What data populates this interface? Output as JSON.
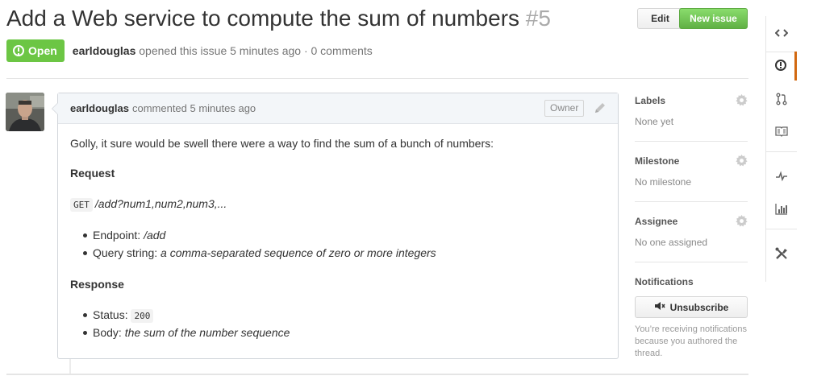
{
  "issue": {
    "title": "Add a Web service to compute the sum of numbers",
    "number": "#5",
    "state": "Open",
    "author": "earldouglas",
    "opened_text": "opened this issue 5 minutes ago · 0 comments"
  },
  "actions": {
    "edit_label": "Edit",
    "new_issue_label": "New issue"
  },
  "comment": {
    "author": "earldouglas",
    "meta": "commented 5 minutes ago",
    "role_label": "Owner",
    "intro": "Golly, it sure would be swell there were a way to find the sum of a bunch of numbers:",
    "request_heading": "Request",
    "request_method": "GET",
    "request_path": "/add?num1,num2,num3,...",
    "endpoint_label": "Endpoint: ",
    "endpoint_value": "/add",
    "query_label": "Query string: ",
    "query_value": "a comma-separated sequence of zero or more integers",
    "response_heading": "Response",
    "status_label": "Status: ",
    "status_value": "200",
    "body_label": "Body: ",
    "body_value": "the sum of the number sequence"
  },
  "sidebar": {
    "labels": {
      "heading": "Labels",
      "value": "None yet"
    },
    "milestone": {
      "heading": "Milestone",
      "value": "No milestone"
    },
    "assignee": {
      "heading": "Assignee",
      "value": "No one assigned"
    },
    "notifications": {
      "heading": "Notifications",
      "button_label": "Unsubscribe",
      "note": "You’re receiving notifications because you authored the thread."
    }
  },
  "rail": {
    "items": [
      "code-icon",
      "issues-icon",
      "pull-requests-icon",
      "wiki-icon",
      "pulse-icon",
      "graphs-icon",
      "settings-icon"
    ],
    "active": "issues-icon"
  },
  "colors": {
    "open_badge": "#6cc644",
    "new_issue_button": "#60b044",
    "rail_active": "#d26911"
  }
}
